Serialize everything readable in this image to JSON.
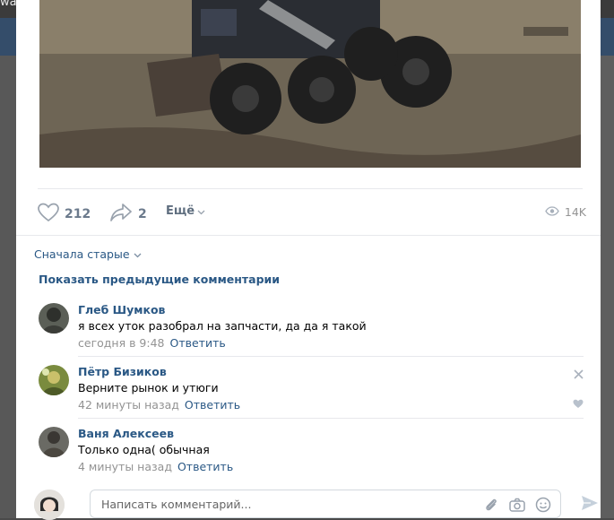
{
  "window": {
    "url_fragment": "wall-92968967_887279_r888014"
  },
  "post": {
    "likes": "212",
    "shares": "2",
    "more_label": "Ещё",
    "views": "14K"
  },
  "comments_section": {
    "sort_label": "Сначала старые",
    "show_previous": "Показать предыдущие комментарии",
    "items": [
      {
        "author": "Глеб Шумков",
        "text": "я всех уток разобрал на запчасти, да да я такой",
        "time": "сегодня в 9:48",
        "reply": "Ответить"
      },
      {
        "author": "Пётр Бизиков",
        "text": "Верните рынок и утюги",
        "time": "42 минуты назад",
        "reply": "Ответить"
      },
      {
        "author": "Ваня Алексеев",
        "text": "Только одна( обычная",
        "time": "4 минуты назад",
        "reply": "Ответить"
      }
    ]
  },
  "composer": {
    "placeholder": "Написать комментарий..."
  },
  "colors": {
    "link": "#2a5885",
    "meta": "#939393",
    "header_bg": "#344d6a"
  },
  "icons": [
    "heart-icon",
    "share-icon",
    "chevron-down-icon",
    "eye-icon",
    "close-icon",
    "paperclip-icon",
    "camera-icon",
    "smile-icon",
    "send-icon"
  ]
}
